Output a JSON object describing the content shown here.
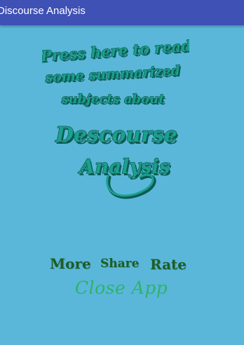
{
  "app_bar": {
    "title": "Discourse Analysis",
    "color": "#3f51b5"
  },
  "background_color": "#5ab7d9",
  "main_image": {
    "lines": [
      "Press here to read",
      "some summarized",
      "subjects about",
      "Descourse",
      "Analysis"
    ],
    "color": "#1aa08e"
  },
  "actions": {
    "more_label": "More",
    "share_label": "Share",
    "rate_label": "Rate",
    "close_label": "Close App",
    "button_color": "#1d5e24",
    "close_color": "#2db36a"
  }
}
